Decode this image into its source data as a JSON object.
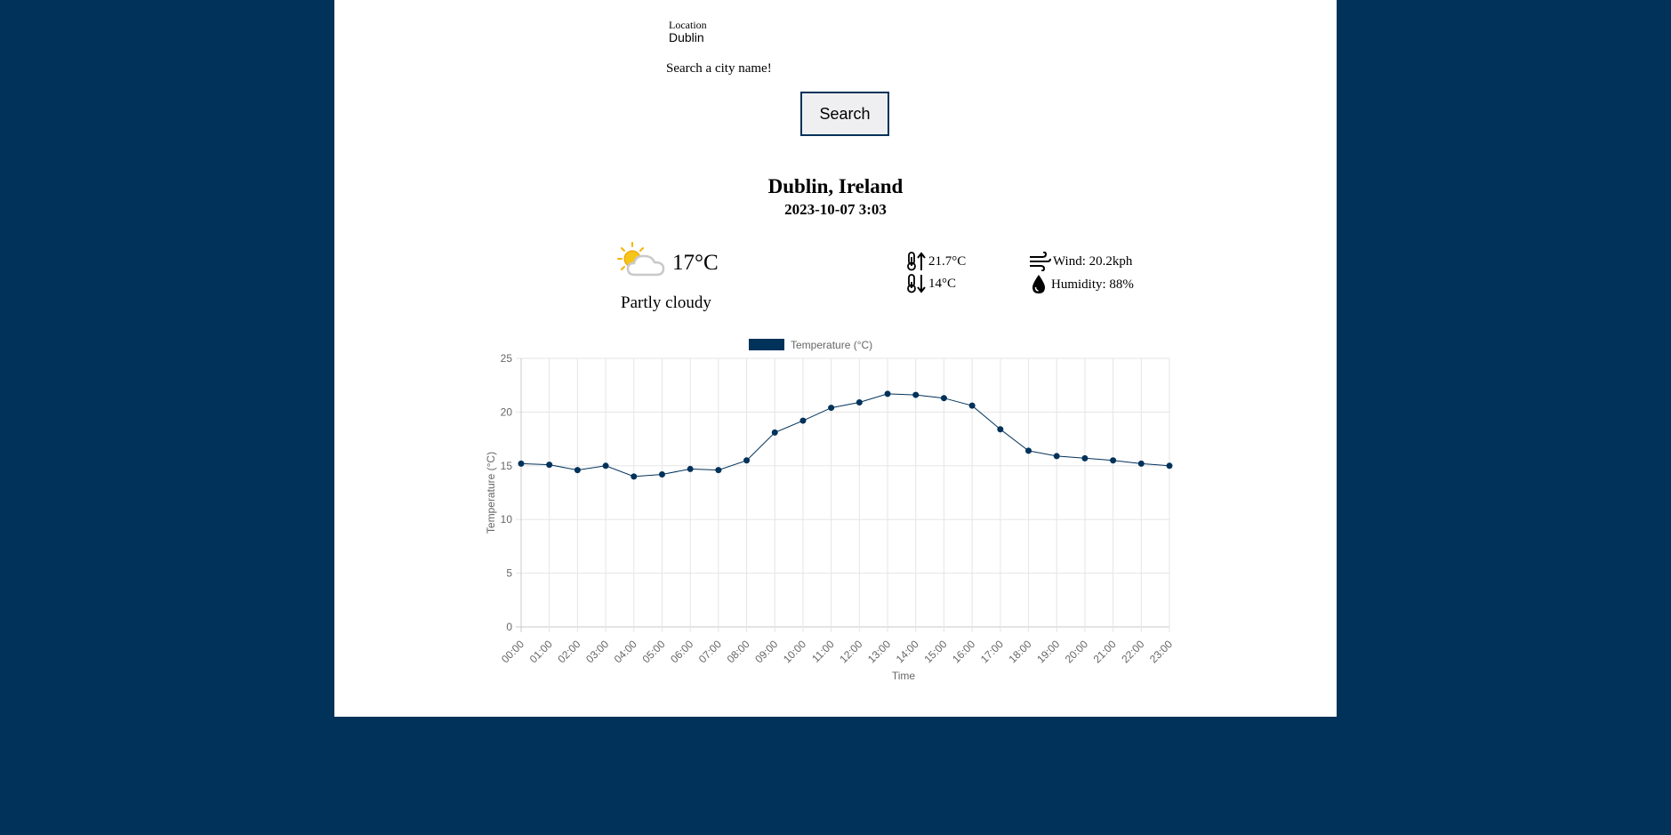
{
  "search": {
    "location_label": "Location",
    "location_value": "Dublin",
    "hint": "Search a city name!",
    "button_label": "Search"
  },
  "weather": {
    "city": "Dublin, Ireland",
    "datetime": "2023-10-07 3:03",
    "temperature": "17°C",
    "condition": "Partly cloudy",
    "condition_icon": "partly-cloudy-icon",
    "max_temp": "21.7°C",
    "min_temp": "14°C",
    "wind": "Wind: 20.2kph",
    "humidity": "Humidity: 88%"
  },
  "colors": {
    "page_background": "#00325a",
    "series": "#00325a",
    "sun": "#f5b400"
  },
  "chart_data": {
    "type": "line",
    "legend": "Temperature (°C)",
    "legend_position": "top",
    "xlabel": "Time",
    "ylabel": "Temperature (°C)",
    "ylim": [
      0,
      25
    ],
    "yticks": [
      0,
      5,
      10,
      15,
      20,
      25
    ],
    "grid": true,
    "categories": [
      "00:00",
      "01:00",
      "02:00",
      "03:00",
      "04:00",
      "05:00",
      "06:00",
      "07:00",
      "08:00",
      "09:00",
      "10:00",
      "11:00",
      "12:00",
      "13:00",
      "14:00",
      "15:00",
      "16:00",
      "17:00",
      "18:00",
      "19:00",
      "20:00",
      "21:00",
      "22:00",
      "23:00"
    ],
    "series": [
      {
        "name": "Temperature (°C)",
        "values": [
          15.2,
          15.1,
          14.6,
          15.0,
          14.0,
          14.2,
          14.7,
          14.6,
          15.5,
          18.1,
          19.2,
          20.4,
          20.9,
          21.7,
          21.6,
          21.3,
          20.6,
          18.4,
          16.4,
          15.9,
          15.7,
          15.5,
          15.2,
          15.0
        ]
      }
    ]
  }
}
